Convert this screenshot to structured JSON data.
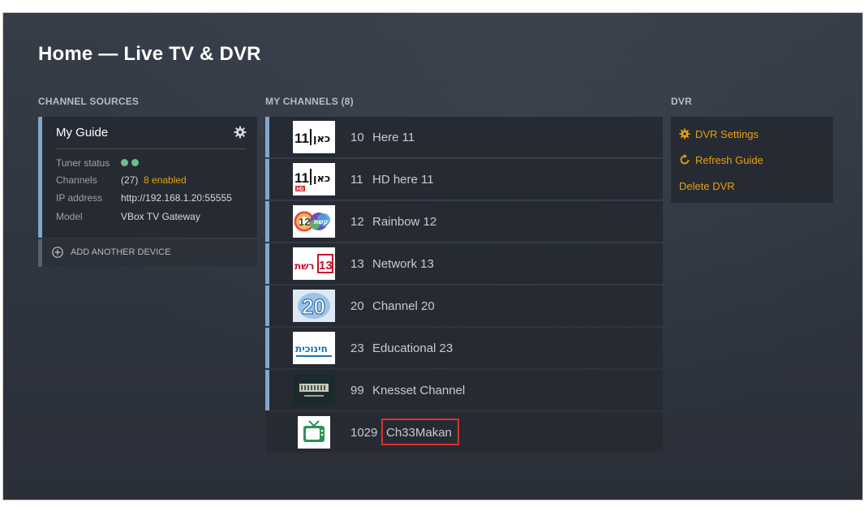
{
  "page": {
    "title": "Home — Live TV & DVR"
  },
  "sections": {
    "sources_label": "CHANNEL SOURCES",
    "channels_label": "MY CHANNELS (8)",
    "dvr_label": "DVR"
  },
  "source": {
    "name": "My Guide",
    "settings_icon": "gear-icon",
    "tuner_status_label": "Tuner status",
    "channels_label": "Channels",
    "channels_total": "(27)",
    "channels_enabled": "8 enabled",
    "ip_label": "IP address",
    "ip_value": "http://192.168.1.20:55555",
    "model_label": "Model",
    "model_value": "VBox TV Gateway"
  },
  "add_device": {
    "label": "ADD ANOTHER DEVICE",
    "icon": "plus-circle-icon"
  },
  "channels": [
    {
      "number": "10",
      "name": "Here 11",
      "logo": "kan-11-logo"
    },
    {
      "number": "11",
      "name": "HD here 11",
      "logo": "kan-11-hd-logo"
    },
    {
      "number": "12",
      "name": "Rainbow 12",
      "logo": "keshet-12-logo"
    },
    {
      "number": "13",
      "name": "Network 13",
      "logo": "reshet-13-logo"
    },
    {
      "number": "20",
      "name": "Channel 20",
      "logo": "channel-20-logo"
    },
    {
      "number": "23",
      "name": "Educational 23",
      "logo": "educational-23-logo"
    },
    {
      "number": "99",
      "name": "Knesset Channel",
      "logo": "knesset-channel-logo"
    },
    {
      "number": "1029",
      "name": "Ch33Makan",
      "logo": "tv-icon"
    }
  ],
  "dvr": {
    "settings": "DVR Settings",
    "refresh": "Refresh Guide",
    "delete": "Delete DVR"
  },
  "logo_text": {
    "kan": "כאן",
    "kan_num": "11",
    "hd": "HD",
    "keshet": "קשת",
    "keshet_num": "12",
    "reshet": "רשת",
    "reshet_num": "13",
    "ch20": "20",
    "educational": "חינוכית"
  },
  "colors": {
    "accent": "#e5a00d",
    "row_border": "#7fa7cf",
    "highlight": "#d6322f",
    "status_dot": "#6fbf8a"
  }
}
